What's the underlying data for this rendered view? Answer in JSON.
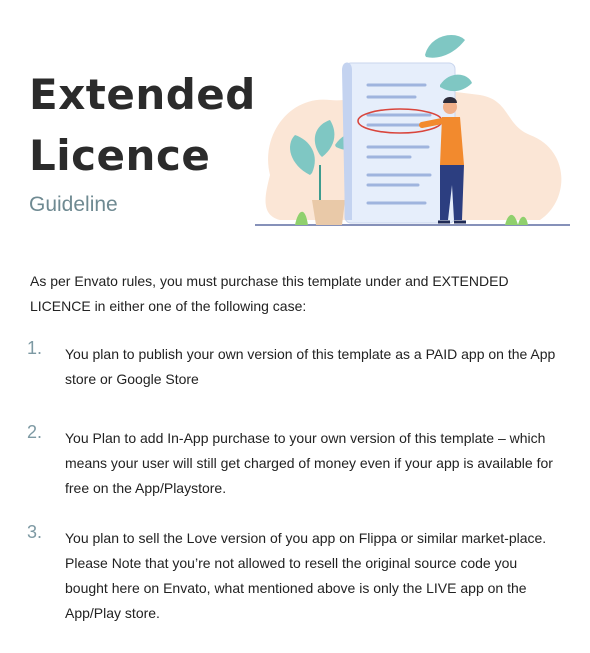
{
  "header": {
    "title_line1": "Extended",
    "title_line2": "Licence",
    "subtitle": "Guideline"
  },
  "intro": "As per Envato rules, you must purchase this template under and EXTENDED LICENCE in either one of the following case:",
  "cases": [
    {
      "number": "1.",
      "text": "You plan to publish your own version of this template as a PAID app on the App store or Google Store"
    },
    {
      "number": "2.",
      "text": "You Plan to add In-App purchase to your own version of this template – which means your user will still get charged of money even if your app is available for free on the App/Playstore."
    },
    {
      "number": "3.",
      "text": "You plan to sell the Love version of you app on Flippa or similar market-place. Please Note that you’re not allowed to resell the original source code you bought here on Envato, what mentioned above is only the LIVE app on the App/Play store."
    }
  ],
  "colors": {
    "title": "#2b2b2b",
    "accent": "#6f8a92",
    "blob": "#fbe6d6",
    "paper": "#e6eefb",
    "leaf": "#7fc7c3",
    "shirt": "#f28a2e",
    "pants": "#2c3e80",
    "circle_mark": "#d9453c"
  },
  "illustration_icon": "document-review-illustration-icon"
}
